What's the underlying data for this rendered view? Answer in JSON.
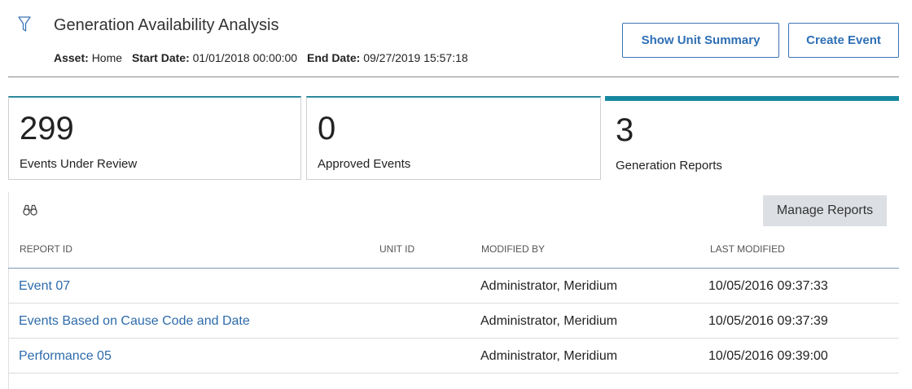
{
  "header": {
    "title": "Generation Availability Analysis",
    "asset_label": "Asset:",
    "asset_value": "Home",
    "start_label": "Start Date:",
    "start_value": "01/01/2018 00:00:00",
    "end_label": "End Date:",
    "end_value": "09/27/2019 15:57:18",
    "filter_icon": "filter-icon"
  },
  "actions": {
    "show_unit_summary": "Show Unit Summary",
    "create_event": "Create Event"
  },
  "tiles": [
    {
      "count": "299",
      "label": "Events Under Review"
    },
    {
      "count": "0",
      "label": "Approved Events"
    },
    {
      "count": "3",
      "label": "Generation Reports"
    }
  ],
  "accent_color": "#1588a0",
  "link_color": "#2d6bab",
  "reports": {
    "search_icon": "binoculars-icon",
    "manage_button": "Manage Reports",
    "columns": [
      "REPORT ID",
      "UNIT ID",
      "MODIFIED BY",
      "LAST MODIFIED"
    ],
    "rows": [
      {
        "report_id": "Event 07",
        "unit_id": "",
        "modified_by": "Administrator, Meridium",
        "last_modified": "10/05/2016 09:37:33"
      },
      {
        "report_id": "Events Based on Cause Code and Date",
        "unit_id": "",
        "modified_by": "Administrator, Meridium",
        "last_modified": "10/05/2016 09:37:39"
      },
      {
        "report_id": "Performance 05",
        "unit_id": "",
        "modified_by": "Administrator, Meridium",
        "last_modified": "10/05/2016 09:39:00"
      }
    ]
  }
}
